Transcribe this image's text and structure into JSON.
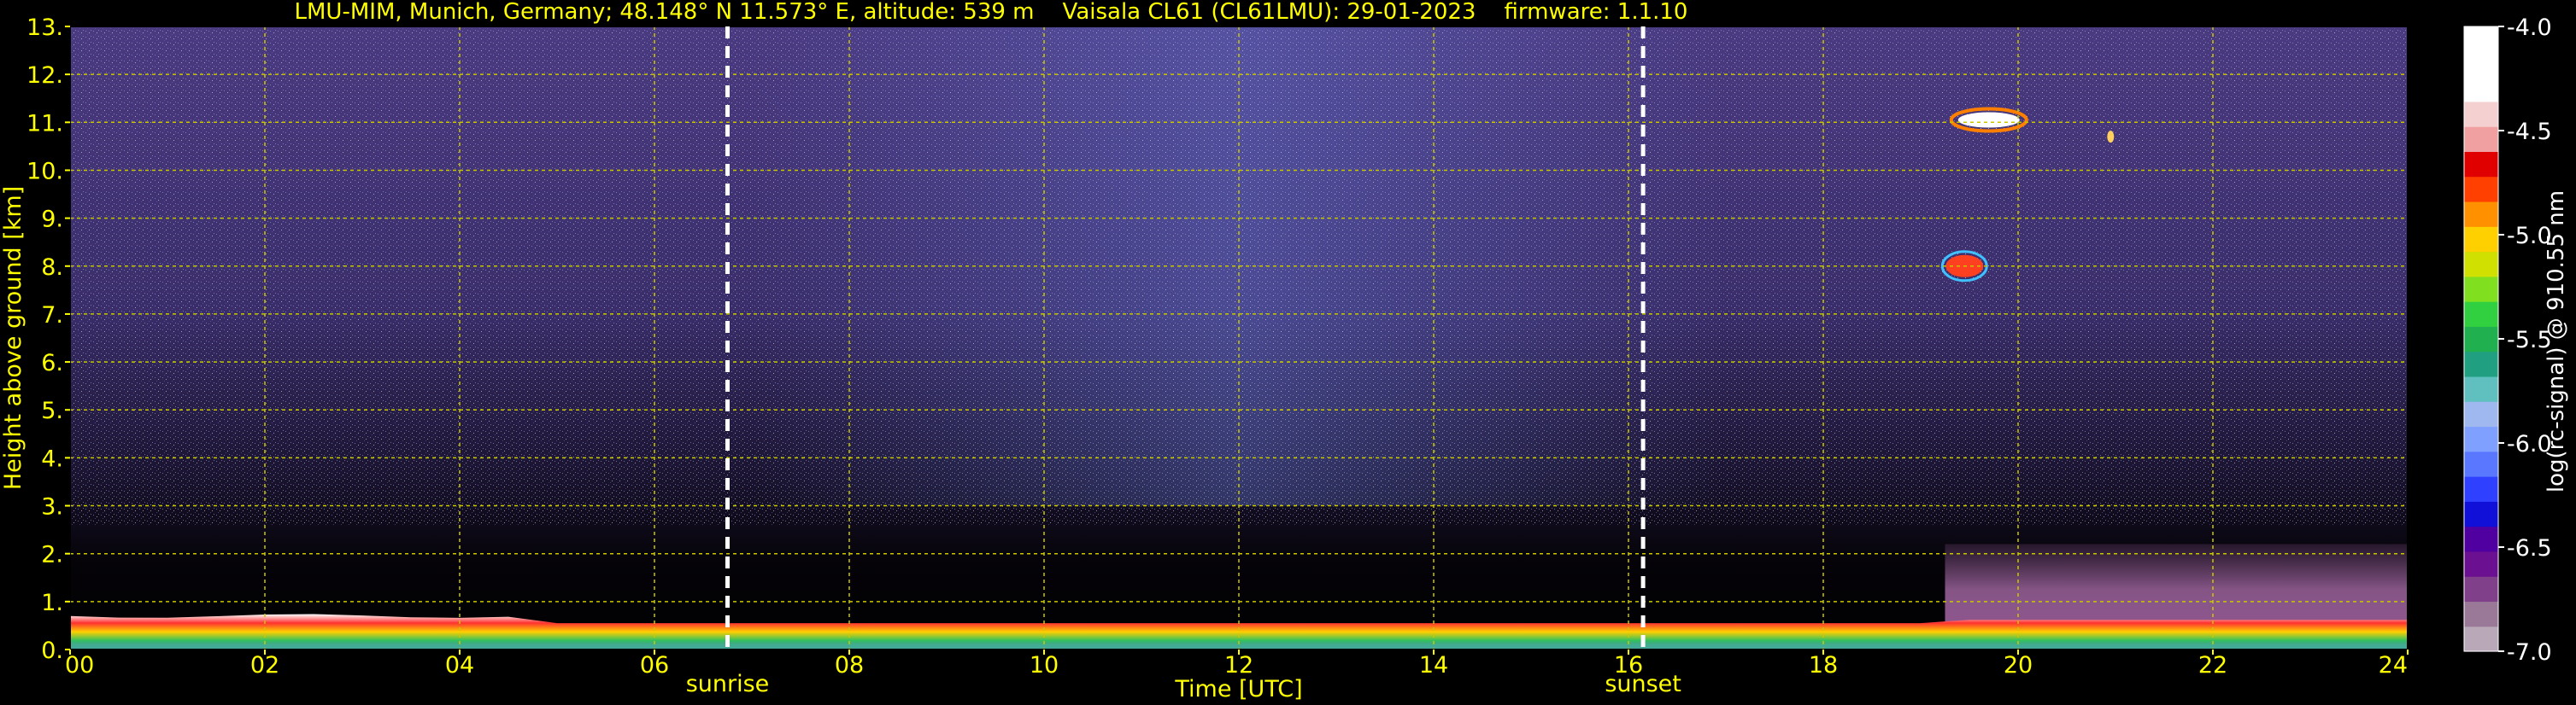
{
  "chart_data": {
    "type": "heatmap",
    "title": "LMU-MIM, Munich, Germany; 48.148° N 11.573° E, altitude: 539 m    Vaisala CL61 (CL61LMU): 29-01-2023    firmware: 1.1.10",
    "xlabel": "Time [UTC]",
    "ylabel": "Height above ground [km]",
    "xlim": [
      0,
      24
    ],
    "ylim": [
      0,
      13
    ],
    "x_ticks": [
      0,
      2,
      4,
      6,
      8,
      10,
      12,
      14,
      16,
      18,
      20,
      22,
      24
    ],
    "x_tick_labels": [
      "00",
      "02",
      "04",
      "06",
      "08",
      "10",
      "12",
      "14",
      "16",
      "18",
      "20",
      "22",
      "24"
    ],
    "y_ticks": [
      0,
      1,
      2,
      3,
      4,
      5,
      6,
      7,
      8,
      9,
      10,
      11,
      12,
      13
    ],
    "y_tick_labels": [
      "0.",
      "1.",
      "2.",
      "3.",
      "4.",
      "5.",
      "6.",
      "7.",
      "8.",
      "9.",
      "10.",
      "11.",
      "12.",
      "13."
    ],
    "grid": true,
    "grid_color": "#c8c800",
    "axis_text_color": "#ffff00",
    "background": "#000000",
    "annotations": [
      {
        "label": "sunrise",
        "x": 6.75
      },
      {
        "label": "sunset",
        "x": 16.15
      }
    ],
    "colorbar": {
      "label": "log(rc-signal) @ 910.55 nm",
      "min": -7.0,
      "max": -4.0,
      "ticks": [
        -7.0,
        -6.5,
        -6.0,
        -5.5,
        -5.0,
        -4.5,
        -4.0
      ],
      "tick_labels": [
        "-7.0",
        "-6.5",
        "-6.0",
        "-5.5",
        "-5.0",
        "-4.5",
        "-4.0"
      ],
      "colors": [
        "#b8a8b8",
        "#9a7898",
        "#80408a",
        "#6a1090",
        "#5000a0",
        "#1010d8",
        "#3040ff",
        "#5a78ff",
        "#80a0ff",
        "#a0b8f0",
        "#60c0c0",
        "#20a080",
        "#20b050",
        "#30d040",
        "#80e020",
        "#d0e000",
        "#ffd000",
        "#ff9000",
        "#ff4000",
        "#e00000",
        "#f0a0a0",
        "#f4d0d0",
        "#ffffff",
        "#ffffff",
        "#ffffff"
      ],
      "text_color": "#ffffff"
    }
  }
}
